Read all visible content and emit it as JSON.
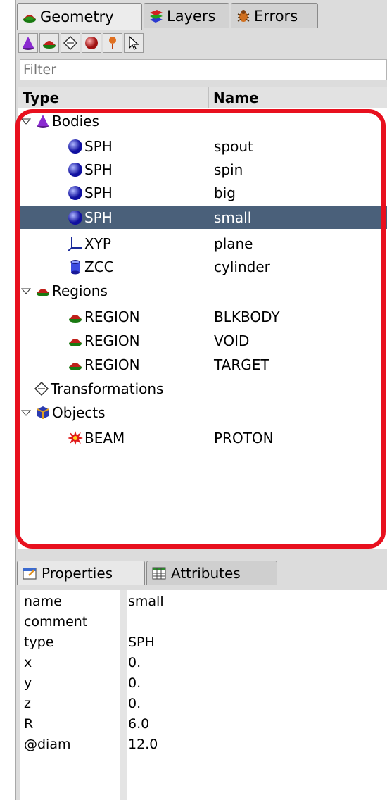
{
  "tabs": [
    {
      "label": "Geometry",
      "icon": "region-icon"
    },
    {
      "label": "Layers",
      "icon": "layers-icon"
    },
    {
      "label": "Errors",
      "icon": "bug-icon"
    }
  ],
  "toolbar": [
    "cone-icon",
    "region-icon",
    "transform-icon",
    "sphere-icon",
    "pin-icon",
    "pointer-icon"
  ],
  "filter": {
    "placeholder": "Filter"
  },
  "columns": {
    "type": "Type",
    "name": "Name"
  },
  "tree": {
    "bodies": {
      "label": "Bodies"
    },
    "b1": {
      "type": "SPH",
      "name": "spout"
    },
    "b2": {
      "type": "SPH",
      "name": "spin"
    },
    "b3": {
      "type": "SPH",
      "name": "big"
    },
    "b4": {
      "type": "SPH",
      "name": "small"
    },
    "b5": {
      "type": "XYP",
      "name": "plane"
    },
    "b6": {
      "type": "ZCC",
      "name": "cylinder"
    },
    "regions": {
      "label": "Regions"
    },
    "r1": {
      "type": "REGION",
      "name": "BLKBODY"
    },
    "r2": {
      "type": "REGION",
      "name": "VOID"
    },
    "r3": {
      "type": "REGION",
      "name": "TARGET"
    },
    "transformations": {
      "label": "Transformations"
    },
    "objects": {
      "label": "Objects"
    },
    "o1": {
      "type": "BEAM",
      "name": "PROTON"
    }
  },
  "bottom_tabs": {
    "properties": "Properties",
    "attributes": "Attributes"
  },
  "properties": [
    {
      "key": "name",
      "value": "small"
    },
    {
      "key": "comment",
      "value": ""
    },
    {
      "key": "type",
      "value": "SPH"
    },
    {
      "key": "x",
      "value": "0."
    },
    {
      "key": "y",
      "value": "0."
    },
    {
      "key": "z",
      "value": "0."
    },
    {
      "key": "R",
      "value": "6.0"
    },
    {
      "key": "@diam",
      "value": "12.0"
    }
  ],
  "colors": {
    "selection": "#4a607a",
    "highlight": "#e8101e"
  }
}
